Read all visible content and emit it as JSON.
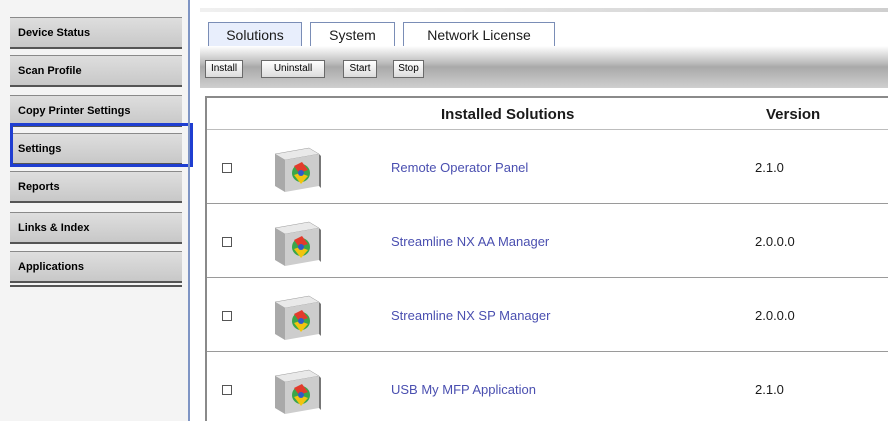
{
  "sidebar": {
    "items": [
      {
        "label": "Device Status"
      },
      {
        "label": "Scan Profile"
      },
      {
        "label": "Copy Printer Settings"
      },
      {
        "label": "Settings"
      },
      {
        "label": "Reports"
      },
      {
        "label": "Links & Index"
      },
      {
        "label": "Applications"
      }
    ],
    "highlighted": "Settings",
    "highlight_color": "#1f3ed1"
  },
  "tabs": [
    {
      "label": "Solutions"
    },
    {
      "label": "System"
    },
    {
      "label": "Network License"
    }
  ],
  "active_tab": "Solutions",
  "toolbar": {
    "install_label": "Install",
    "uninstall_label": "Uninstall",
    "start_label": "Start",
    "stop_label": "Stop"
  },
  "table": {
    "columns": {
      "name": "Installed Solutions",
      "version": "Version"
    },
    "rows": [
      {
        "name": "Remote Operator Panel",
        "version": "2.1.0",
        "icon": "solution-cube-icon"
      },
      {
        "name": "Streamline NX AA Manager",
        "version": "2.0.0.0",
        "icon": "solution-cube-icon"
      },
      {
        "name": "Streamline NX SP Manager",
        "version": "2.0.0.0",
        "icon": "solution-cube-icon"
      },
      {
        "name": "USB My MFP Application",
        "version": "2.1.0",
        "icon": "solution-cube-icon"
      }
    ]
  },
  "colors": {
    "link": "#4a4fb0",
    "divider": "#7f95c4"
  }
}
